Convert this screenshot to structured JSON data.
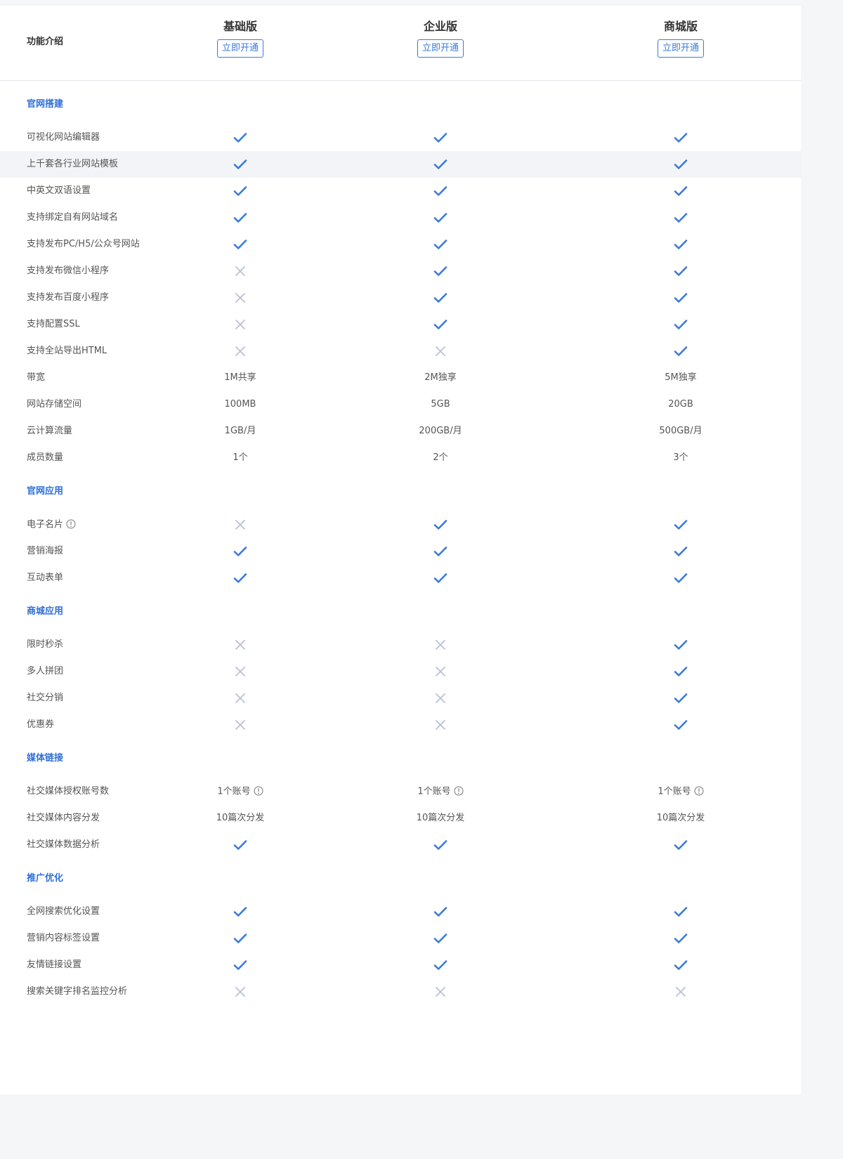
{
  "colors": {
    "accent": "#2f6fd6",
    "check": "#3a7ad9",
    "cross": "#b8c2d6",
    "highlight_row": "#f3f4f7"
  },
  "header": {
    "title": "功能介绍",
    "plans": [
      {
        "name": "基础版",
        "button": "立即开通"
      },
      {
        "name": "企业版",
        "button": "立即开通"
      },
      {
        "name": "商城版",
        "button": "立即开通"
      }
    ]
  },
  "sections": [
    {
      "title": "官网搭建",
      "rows": [
        {
          "label": "可视化网站编辑器",
          "values": [
            {
              "type": "check"
            },
            {
              "type": "check"
            },
            {
              "type": "check"
            }
          ]
        },
        {
          "label": "上千套各行业网站模板",
          "highlight": true,
          "values": [
            {
              "type": "check"
            },
            {
              "type": "check"
            },
            {
              "type": "check"
            }
          ]
        },
        {
          "label": "中英文双语设置",
          "values": [
            {
              "type": "check"
            },
            {
              "type": "check"
            },
            {
              "type": "check"
            }
          ]
        },
        {
          "label": "支持绑定自有网站域名",
          "values": [
            {
              "type": "check"
            },
            {
              "type": "check"
            },
            {
              "type": "check"
            }
          ]
        },
        {
          "label": "支持发布PC/H5/公众号网站",
          "values": [
            {
              "type": "check"
            },
            {
              "type": "check"
            },
            {
              "type": "check"
            }
          ]
        },
        {
          "label": "支持发布微信小程序",
          "values": [
            {
              "type": "cross"
            },
            {
              "type": "check"
            },
            {
              "type": "check"
            }
          ]
        },
        {
          "label": "支持发布百度小程序",
          "values": [
            {
              "type": "cross"
            },
            {
              "type": "check"
            },
            {
              "type": "check"
            }
          ]
        },
        {
          "label": "支持配置SSL",
          "values": [
            {
              "type": "cross"
            },
            {
              "type": "check"
            },
            {
              "type": "check"
            }
          ]
        },
        {
          "label": "支持全站导出HTML",
          "values": [
            {
              "type": "cross"
            },
            {
              "type": "cross"
            },
            {
              "type": "check"
            }
          ]
        },
        {
          "label": "带宽",
          "values": [
            {
              "type": "text",
              "text": "1M共享"
            },
            {
              "type": "text",
              "text": "2M独享"
            },
            {
              "type": "text",
              "text": "5M独享"
            }
          ]
        },
        {
          "label": "网站存储空间",
          "values": [
            {
              "type": "text",
              "text": "100MB"
            },
            {
              "type": "text",
              "text": "5GB"
            },
            {
              "type": "text",
              "text": "20GB"
            }
          ]
        },
        {
          "label": "云计算流量",
          "values": [
            {
              "type": "text",
              "text": "1GB/月"
            },
            {
              "type": "text",
              "text": "200GB/月"
            },
            {
              "type": "text",
              "text": "500GB/月"
            }
          ]
        },
        {
          "label": "成员数量",
          "values": [
            {
              "type": "text",
              "text": "1个"
            },
            {
              "type": "text",
              "text": "2个"
            },
            {
              "type": "text",
              "text": "3个"
            }
          ]
        }
      ]
    },
    {
      "title": "官网应用",
      "rows": [
        {
          "label": "电子名片",
          "info": true,
          "values": [
            {
              "type": "cross"
            },
            {
              "type": "check"
            },
            {
              "type": "check"
            }
          ]
        },
        {
          "label": "营销海报",
          "values": [
            {
              "type": "check"
            },
            {
              "type": "check"
            },
            {
              "type": "check"
            }
          ]
        },
        {
          "label": "互动表单",
          "values": [
            {
              "type": "check"
            },
            {
              "type": "check"
            },
            {
              "type": "check"
            }
          ]
        }
      ]
    },
    {
      "title": "商城应用",
      "rows": [
        {
          "label": "限时秒杀",
          "values": [
            {
              "type": "cross"
            },
            {
              "type": "cross"
            },
            {
              "type": "check"
            }
          ]
        },
        {
          "label": "多人拼团",
          "values": [
            {
              "type": "cross"
            },
            {
              "type": "cross"
            },
            {
              "type": "check"
            }
          ]
        },
        {
          "label": "社交分销",
          "values": [
            {
              "type": "cross"
            },
            {
              "type": "cross"
            },
            {
              "type": "check"
            }
          ]
        },
        {
          "label": "优惠券",
          "values": [
            {
              "type": "cross"
            },
            {
              "type": "cross"
            },
            {
              "type": "check"
            }
          ]
        }
      ]
    },
    {
      "title": "媒体链接",
      "rows": [
        {
          "label": "社交媒体授权账号数",
          "values": [
            {
              "type": "text",
              "text": "1个账号",
              "info": true
            },
            {
              "type": "text",
              "text": "1个账号",
              "info": true
            },
            {
              "type": "text",
              "text": "1个账号",
              "info": true
            }
          ]
        },
        {
          "label": "社交媒体内容分发",
          "values": [
            {
              "type": "text",
              "text": "10篇次分发"
            },
            {
              "type": "text",
              "text": "10篇次分发"
            },
            {
              "type": "text",
              "text": "10篇次分发"
            }
          ]
        },
        {
          "label": "社交媒体数据分析",
          "values": [
            {
              "type": "check"
            },
            {
              "type": "check"
            },
            {
              "type": "check"
            }
          ]
        }
      ]
    },
    {
      "title": "推广优化",
      "rows": [
        {
          "label": "全网搜索优化设置",
          "values": [
            {
              "type": "check"
            },
            {
              "type": "check"
            },
            {
              "type": "check"
            }
          ]
        },
        {
          "label": "营销内容标签设置",
          "values": [
            {
              "type": "check"
            },
            {
              "type": "check"
            },
            {
              "type": "check"
            }
          ]
        },
        {
          "label": "友情链接设置",
          "values": [
            {
              "type": "check"
            },
            {
              "type": "check"
            },
            {
              "type": "check"
            }
          ]
        },
        {
          "label": "搜索关键字排名监控分析",
          "values": [
            {
              "type": "cross"
            },
            {
              "type": "cross"
            },
            {
              "type": "cross"
            }
          ]
        }
      ]
    }
  ]
}
